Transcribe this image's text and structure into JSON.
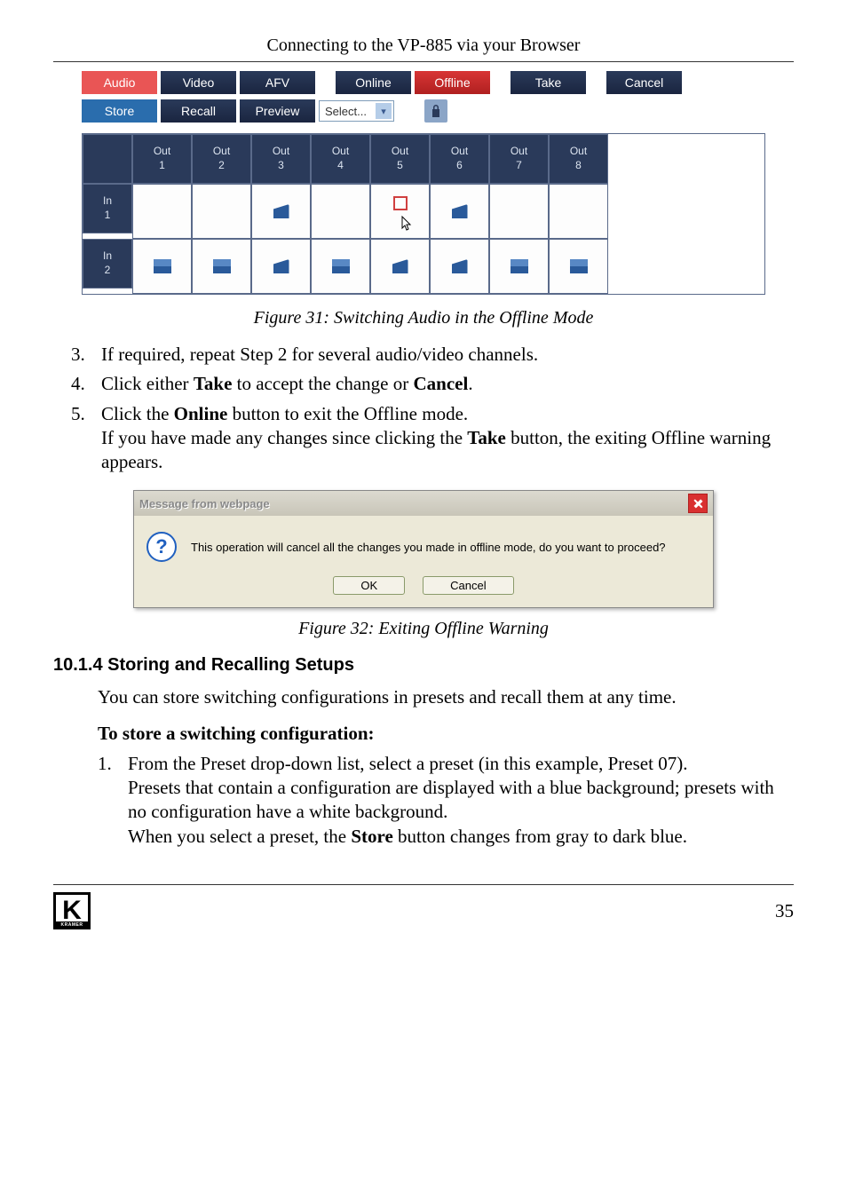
{
  "header": "Connecting to the VP-885 via your Browser",
  "tabs_top": {
    "audio": "Audio",
    "video": "Video",
    "afv": "AFV",
    "online": "Online",
    "offline": "Offline",
    "take": "Take",
    "cancel": "Cancel"
  },
  "tabs_bottom": {
    "store": "Store",
    "recall": "Recall",
    "preview": "Preview",
    "select": "Select..."
  },
  "grid": {
    "out_labels": [
      "Out\n1",
      "Out\n2",
      "Out\n3",
      "Out\n4",
      "Out\n5",
      "Out\n6",
      "Out\n7",
      "Out\n8"
    ],
    "in_labels": [
      "In\n1",
      "In\n2"
    ]
  },
  "caption1": "Figure 31: Switching Audio in the Offline Mode",
  "steps_a": {
    "s3": {
      "num": "3.",
      "text_a": "If required, repeat Step 2 for several audio/video channels."
    },
    "s4": {
      "num": "4.",
      "prefix": "Click either ",
      "bold1": "Take",
      "mid": " to accept the change or ",
      "bold2": "Cancel",
      "suffix": "."
    },
    "s5": {
      "num": "5.",
      "prefix": "Click the ",
      "bold1": "Online",
      "mid": " button to exit the Offline mode.\nIf you have made any changes since clicking the ",
      "bold2": "Take",
      "suffix": " button, the exiting Offline warning appears."
    }
  },
  "dialog": {
    "title": "Message from webpage",
    "body": "This operation will cancel all the changes you made in offline mode, do you want to proceed?",
    "ok": "OK",
    "cancel": "Cancel"
  },
  "caption2": "Figure 32: Exiting Offline Warning",
  "heading_10_1_4": "10.1.4 Storing and Recalling Setups",
  "para1": "You can store switching configurations in presets and recall them at any time.",
  "para2": "To store a switching configuration:",
  "step1": {
    "num": "1.",
    "line1": "From the Preset drop-down list, select a preset (in this example, Preset 07).",
    "line2": "Presets that contain a configuration are displayed with a blue background; presets with no configuration have a white background.",
    "line3_a": "When you select a preset, the ",
    "line3_bold": "Store",
    "line3_b": " button changes from gray to dark blue."
  },
  "page_number": "35"
}
